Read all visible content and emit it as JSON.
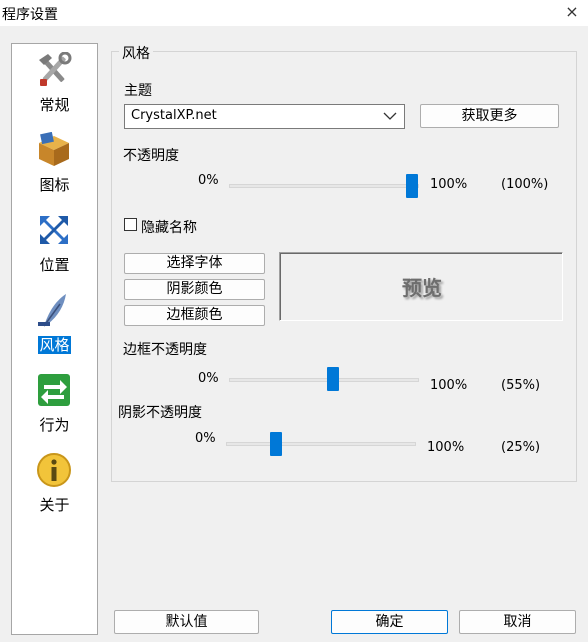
{
  "window": {
    "title": "程序设置",
    "close_glyph": "×"
  },
  "sidebar": {
    "items": [
      {
        "label": "常规",
        "icon": "tools-icon",
        "selected": false
      },
      {
        "label": "图标",
        "icon": "box-icon",
        "selected": false
      },
      {
        "label": "位置",
        "icon": "position-arrows-icon",
        "selected": false
      },
      {
        "label": "风格",
        "icon": "quill-pen-icon",
        "selected": true
      },
      {
        "label": "行为",
        "icon": "exchange-arrows-icon",
        "selected": false
      },
      {
        "label": "关于",
        "icon": "info-icon",
        "selected": false
      }
    ]
  },
  "style": {
    "group_title": "风格",
    "theme": {
      "label": "主题",
      "value": "CrystalXP.net",
      "get_more_label": "获取更多"
    },
    "opacity": {
      "label": "不透明度",
      "min_label": "0%",
      "max_label": "100%",
      "value_label": "(100%)",
      "value": 100
    },
    "hide_name": {
      "label": "隐藏名称",
      "checked": false
    },
    "buttons": {
      "font": "选择字体",
      "shadow_color": "阴影颜色",
      "border_color": "边框颜色"
    },
    "preview_text": "预览",
    "border_opacity": {
      "label": "边框不透明度",
      "min_label": "0%",
      "max_label": "100%",
      "value_label": "(55%)",
      "value": 55
    },
    "shadow_opacity": {
      "label": "阴影不透明度",
      "min_label": "0%",
      "max_label": "100%",
      "value_label": "(25%)",
      "value": 25
    }
  },
  "footer": {
    "default_label": "默认值",
    "ok_label": "确定",
    "cancel_label": "取消"
  },
  "colors": {
    "accent": "#0078d7",
    "selection": "#0078d7"
  }
}
